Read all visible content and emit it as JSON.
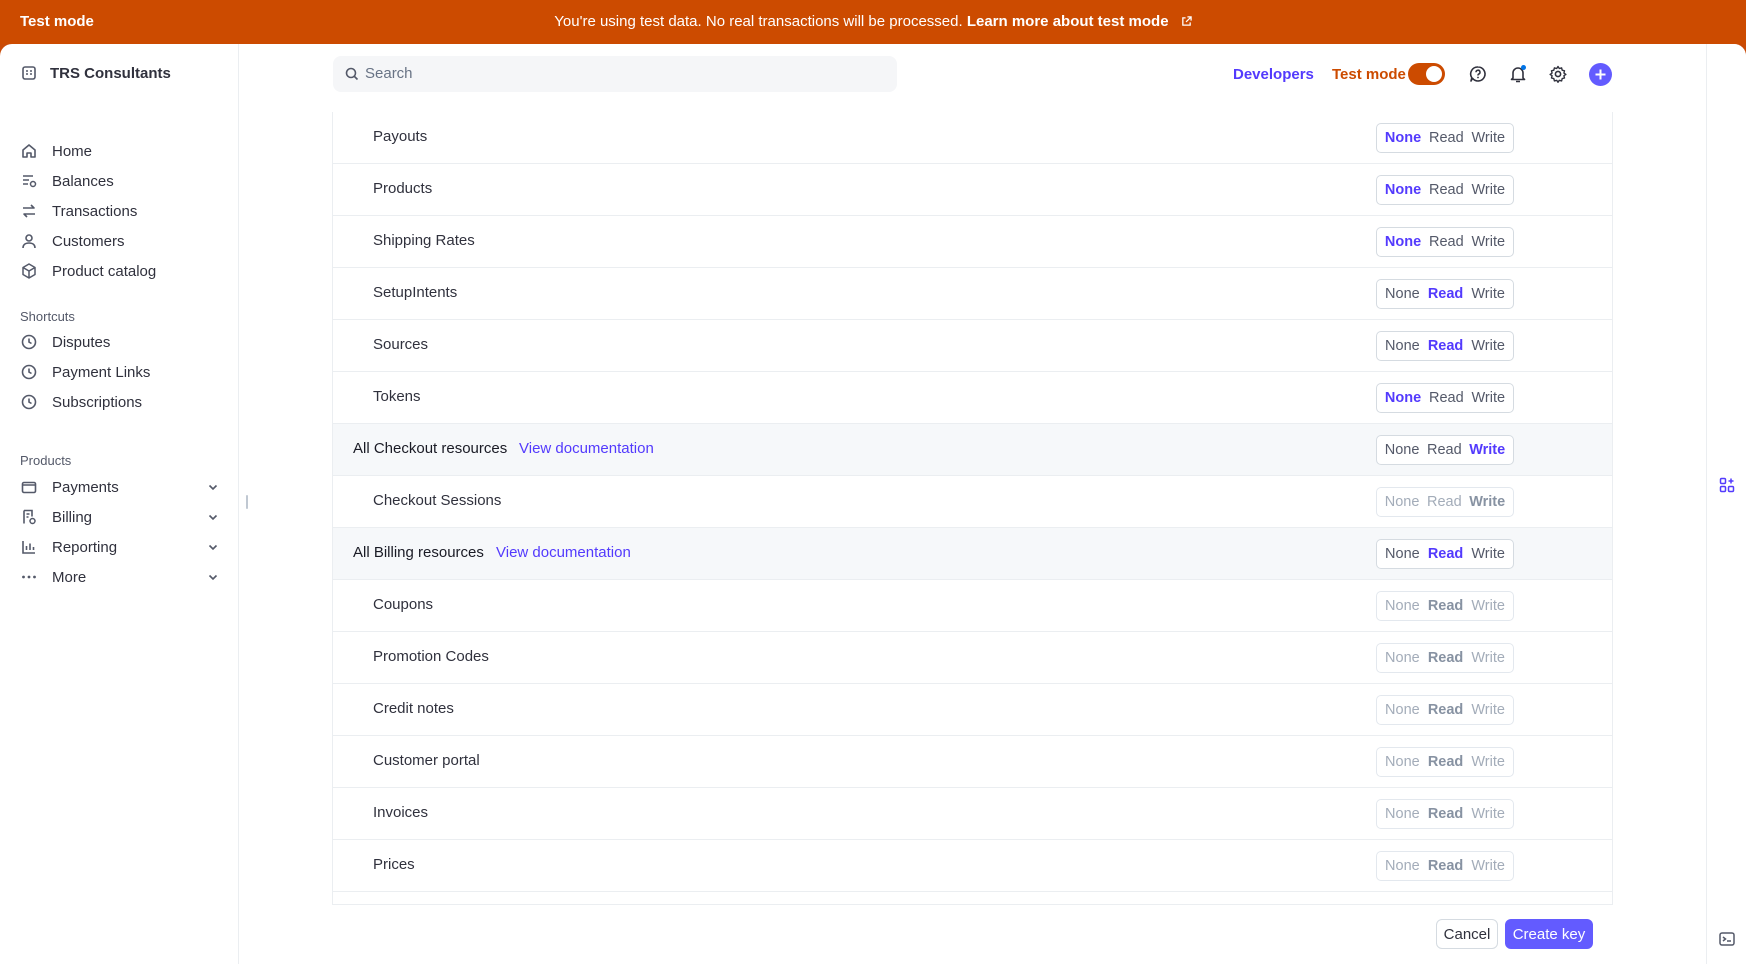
{
  "banner": {
    "title": "Test mode",
    "message": "You're using test data. No real transactions will be processed.",
    "link": "Learn more about test mode"
  },
  "sidebar": {
    "account": "TRS Consultants",
    "nav": [
      "Home",
      "Balances",
      "Transactions",
      "Customers",
      "Product catalog"
    ],
    "shortcuts_title": "Shortcuts",
    "shortcuts": [
      "Disputes",
      "Payment Links",
      "Subscriptions"
    ],
    "products_title": "Products",
    "products": [
      "Payments",
      "Billing",
      "Reporting",
      "More"
    ]
  },
  "topbar": {
    "search_placeholder": "Search",
    "developers": "Developers",
    "test_mode": "Test mode",
    "test_mode_on": true
  },
  "permission_options": [
    "None",
    "Read",
    "Write"
  ],
  "rows": [
    {
      "name": "Payouts",
      "value": "None",
      "group": false,
      "disabled": false
    },
    {
      "name": "Products",
      "value": "None",
      "group": false,
      "disabled": false
    },
    {
      "name": "Shipping Rates",
      "value": "None",
      "group": false,
      "disabled": false
    },
    {
      "name": "SetupIntents",
      "value": "Read",
      "group": false,
      "disabled": false
    },
    {
      "name": "Sources",
      "value": "Read",
      "group": false,
      "disabled": false
    },
    {
      "name": "Tokens",
      "value": "None",
      "group": false,
      "disabled": false
    },
    {
      "name": "All Checkout resources",
      "value": "Write",
      "group": true,
      "disabled": false,
      "doc_link": "View documentation"
    },
    {
      "name": "Checkout Sessions",
      "value": "Write",
      "group": false,
      "disabled": true
    },
    {
      "name": "All Billing resources",
      "value": "Read",
      "group": true,
      "disabled": false,
      "doc_link": "View documentation"
    },
    {
      "name": "Coupons",
      "value": "Read",
      "group": false,
      "disabled": true
    },
    {
      "name": "Promotion Codes",
      "value": "Read",
      "group": false,
      "disabled": true
    },
    {
      "name": "Credit notes",
      "value": "Read",
      "group": false,
      "disabled": true
    },
    {
      "name": "Customer portal",
      "value": "Read",
      "group": false,
      "disabled": true
    },
    {
      "name": "Invoices",
      "value": "Read",
      "group": false,
      "disabled": true
    },
    {
      "name": "Prices",
      "value": "Read",
      "group": false,
      "disabled": true
    }
  ],
  "footer": {
    "cancel": "Cancel",
    "create": "Create key"
  },
  "colors": {
    "accent": "#533afd",
    "test_mode_orange": "#cc4b00"
  }
}
